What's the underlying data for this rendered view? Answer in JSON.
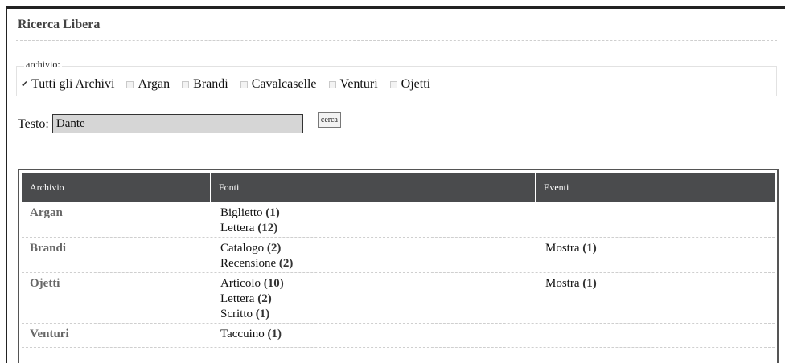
{
  "panel": {
    "title": "Ricerca Libera"
  },
  "archive_filter": {
    "legend": "archivio:",
    "options": [
      {
        "label": "Tutti gli Archivi",
        "checked": true
      },
      {
        "label": "Argan",
        "checked": false
      },
      {
        "label": "Brandi",
        "checked": false
      },
      {
        "label": "Cavalcaselle",
        "checked": false
      },
      {
        "label": "Venturi",
        "checked": false
      },
      {
        "label": "Ojetti",
        "checked": false
      }
    ]
  },
  "search": {
    "label": "Testo:",
    "value": "Dante",
    "button_label": "cerca"
  },
  "results": {
    "headers": [
      "Archivio",
      "Fonti",
      "Eventi"
    ],
    "rows": [
      {
        "archivio": "Argan",
        "fonti": [
          {
            "name": "Biglietto",
            "count": "(1)"
          },
          {
            "name": "Lettera",
            "count": "(12)"
          }
        ],
        "eventi": []
      },
      {
        "archivio": "Brandi",
        "fonti": [
          {
            "name": "Catalogo",
            "count": "(2)"
          },
          {
            "name": "Recensione",
            "count": "(2)"
          }
        ],
        "eventi": [
          {
            "name": "Mostra",
            "count": "(1)"
          }
        ]
      },
      {
        "archivio": "Ojetti",
        "fonti": [
          {
            "name": "Articolo",
            "count": "(10)"
          },
          {
            "name": "Lettera",
            "count": "(2)"
          },
          {
            "name": "Scritto",
            "count": "(1)"
          }
        ],
        "eventi": [
          {
            "name": "Mostra",
            "count": "(1)"
          }
        ]
      },
      {
        "archivio": "Venturi",
        "fonti": [
          {
            "name": "Taccuino",
            "count": "(1)"
          }
        ],
        "eventi": []
      }
    ]
  }
}
